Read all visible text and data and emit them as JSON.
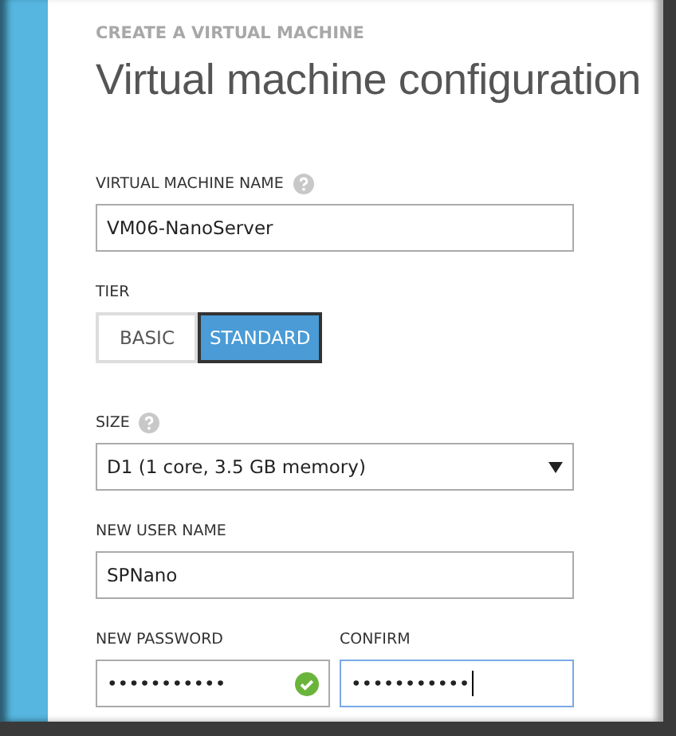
{
  "heading": "CREATE A VIRTUAL MACHINE",
  "title": "Virtual machine configuration",
  "vm_name": {
    "label": "VIRTUAL MACHINE NAME",
    "value": "VM06-NanoServer",
    "help": true
  },
  "tier": {
    "label": "TIER",
    "options": [
      {
        "label": "BASIC",
        "selected": false
      },
      {
        "label": "STANDARD",
        "selected": true
      }
    ]
  },
  "size": {
    "label": "SIZE",
    "value": "D1 (1 core, 3.5 GB memory)",
    "help": true
  },
  "user_name": {
    "label": "NEW USER NAME",
    "value": "SPNano"
  },
  "password": {
    "label": "NEW PASSWORD",
    "value": "•••••••••••",
    "valid": true,
    "focused": false
  },
  "confirm": {
    "label": "CONFIRM",
    "value": "•••••••••••",
    "valid": false,
    "focused": true
  }
}
